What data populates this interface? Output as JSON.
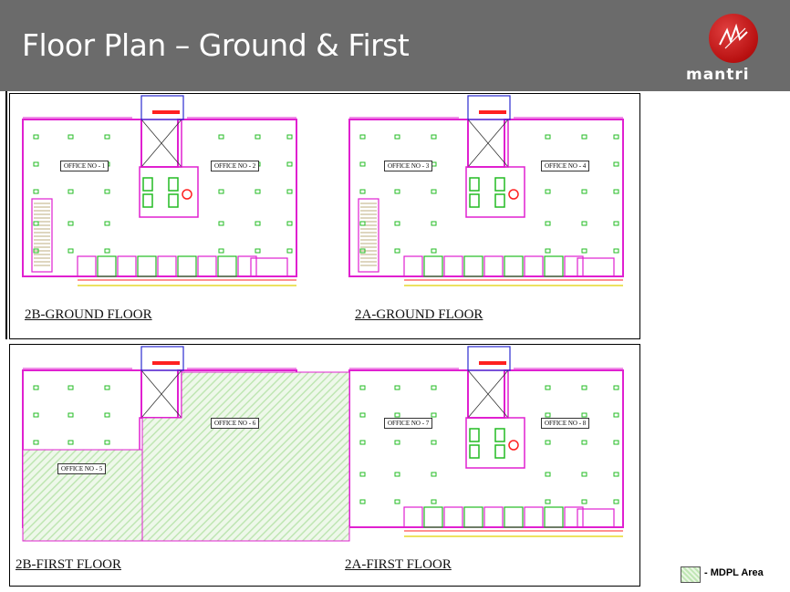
{
  "header": {
    "title": "Floor Plan – Ground & First",
    "logo_text": "mantri"
  },
  "panels": {
    "ground": {
      "left_floor": "2B-GROUND FLOOR",
      "right_floor": "2A-GROUND FLOOR",
      "offices": [
        "OFFICE NO - 1",
        "OFFICE NO - 2",
        "OFFICE NO - 3",
        "OFFICE NO - 4"
      ]
    },
    "first": {
      "left_floor": "2B-FIRST FLOOR",
      "right_floor": "2A-FIRST FLOOR",
      "offices": [
        "OFFICE NO - 5",
        "OFFICE NO - 6",
        "OFFICE NO - 7",
        "OFFICE NO - 8"
      ]
    }
  },
  "legend": {
    "label": "- MDPL Area",
    "color": "#bfe6b3"
  },
  "colors": {
    "header_bg": "#6b6b6b",
    "wall": "#e020d0",
    "column": "#22bb22",
    "stair": "#2b2bd0",
    "accent": "#ff2020"
  }
}
